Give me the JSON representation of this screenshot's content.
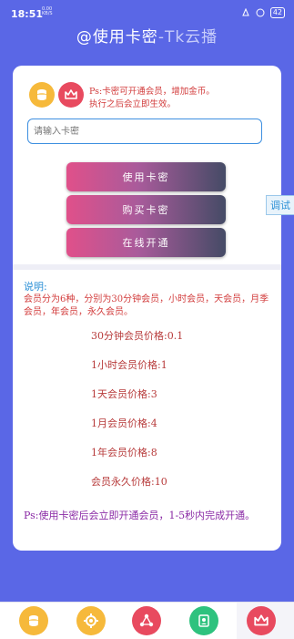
{
  "status": {
    "time": "18:51",
    "net": "0.00\nKB/S",
    "battery": "42"
  },
  "app": {
    "title_main": "@使用卡密",
    "title_tag": "-Tk云播"
  },
  "card": {
    "ps_note": "Ps:卡密可开通会员，增加金币。\n执行之后会立即生效。",
    "input_placeholder": "请输入卡密",
    "btn_use": "使用卡密",
    "btn_buy": "购买卡密",
    "btn_online": "在线开通"
  },
  "explain": {
    "head": "说明:",
    "body": "会员分为6种，分别为30分钟会员，小时会员，天会员，月季会员，年会员，永久会员。",
    "prices": [
      "30分钟会员价格:0.1",
      "1小时会员价格:1",
      "1天会员价格:3",
      "1月会员价格:4",
      "1年会员价格:8",
      "会员永久价格:10"
    ],
    "tail": "Ps:使用卡密后会立即开通会员，1-5秒内完成开通。"
  },
  "debug_tab": "调试",
  "colors": {
    "accent": "#5a67e6",
    "gold": "#f6b93b",
    "red": "#e84a5f",
    "green": "#2ec27e",
    "link_blue": "#2a8fd6"
  },
  "bottom_nav": [
    {
      "icon": "coins-icon"
    },
    {
      "icon": "gear-icon"
    },
    {
      "icon": "share-icon"
    },
    {
      "icon": "contact-icon"
    },
    {
      "icon": "crown-icon"
    }
  ]
}
